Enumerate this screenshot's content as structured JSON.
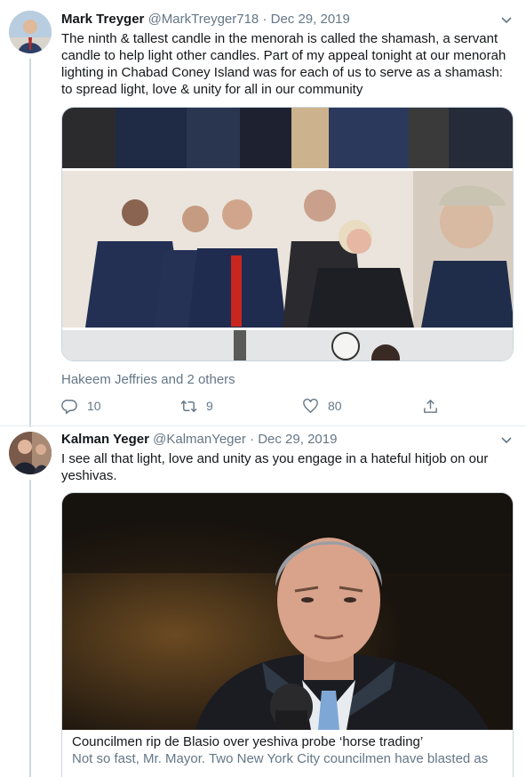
{
  "tweets": [
    {
      "name": "Mark Treyger",
      "handle": "@MarkTreyger718",
      "separator": "·",
      "date": "Dec 29, 2019",
      "text": "The ninth & tallest candle in the menorah is called the shamash, a servant candle to help light other candles. Part of my appeal tonight at our menorah lighting in Chabad Coney Island was for each of us to serve as a shamash: to spread light, love & unity for all in our community",
      "liked_by": "Hakeem Jeffries and 2 others",
      "replies": "10",
      "retweets": "9",
      "likes": "80"
    },
    {
      "name": "Kalman Yeger",
      "handle": "@KalmanYeger",
      "separator": "·",
      "date": "Dec 29, 2019",
      "text": "I see all that light, love and unity as you engage in a hateful hitjob on our yeshivas.",
      "card": {
        "title": "Councilmen rip de Blasio over yeshiva probe ‘horse trading’",
        "description": "Not so fast, Mr. Mayor. Two New York City councilmen have blasted as"
      }
    }
  ],
  "icons": {
    "reply": "reply-icon",
    "retweet": "retweet-icon",
    "like": "heart-icon",
    "share": "share-icon",
    "caret": "chevron-down-icon"
  },
  "colors": {
    "text": "#14171a",
    "secondary": "#657786",
    "border": "#ccd6dd",
    "thread": "#cfd9de"
  }
}
